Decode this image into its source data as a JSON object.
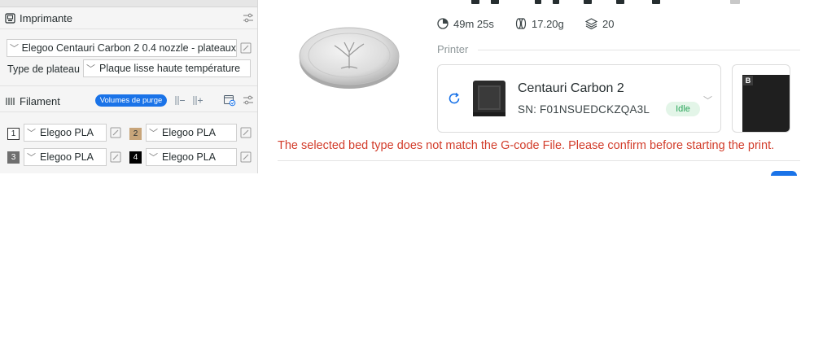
{
  "left_panel": {
    "printer_section": {
      "title": "Imprimante",
      "preset": "Elegoo Centauri Carbon 2 0.4 nozzle - plateaux",
      "bed_type_label": "Type de plateau",
      "bed_type_value": "Plaque lisse haute température"
    },
    "filament_section": {
      "title": "Filament",
      "purge_button": "Volumes de purge",
      "slots": [
        {
          "number": "1",
          "name": "Elegoo PLA",
          "swatch": "#ffffff",
          "num_color": "#262e30"
        },
        {
          "number": "2",
          "name": "Elegoo PLA",
          "swatch": "#c8a57a",
          "num_color": "#262e30"
        },
        {
          "number": "3",
          "name": "Elegoo PLA",
          "swatch": "#6f6f6f",
          "num_color": "#ffffff"
        },
        {
          "number": "4",
          "name": "Elegoo PLA",
          "swatch": "#000000",
          "num_color": "#ffffff"
        }
      ]
    }
  },
  "print_dialog": {
    "stats": {
      "time": "49m 25s",
      "weight": "17.20g",
      "layers": "20"
    },
    "printer_label": "Printer",
    "printer": {
      "name": "Centauri Carbon 2",
      "serial": "SN: F01NSUEDCKZQA3L",
      "status": "Idle"
    },
    "plate_badge": "B",
    "warning": "The selected bed type does not match the G-code File. Please confirm before starting the print."
  },
  "colors": {
    "accent": "#1a73e8",
    "warning": "#d23c2a",
    "idle_text": "#2aa55a",
    "idle_bg": "#e3f5e8"
  }
}
